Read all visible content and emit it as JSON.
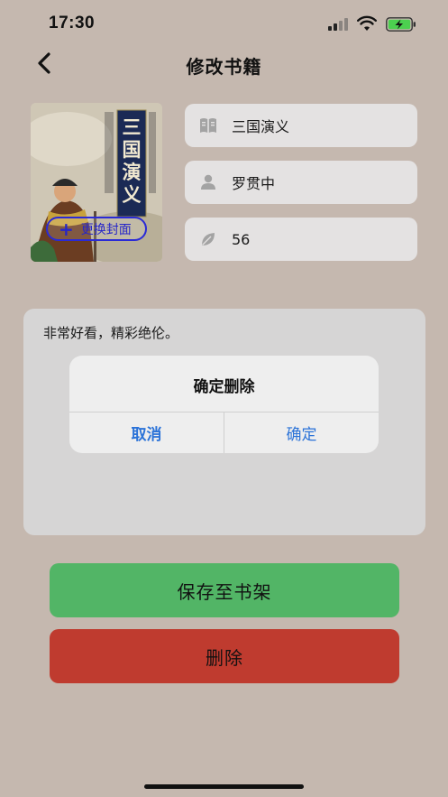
{
  "status_bar": {
    "time": "17:30",
    "icons": [
      "cellular-signal-icon",
      "wifi-icon",
      "battery-charging-icon"
    ]
  },
  "nav": {
    "title": "修改书籍",
    "back_icon": "chevron-left-icon"
  },
  "cover": {
    "book_title_on_cover": "三国演义",
    "change_cover_label": "更换封面",
    "plus_glyph": "+"
  },
  "fields": {
    "title": {
      "icon": "book-icon",
      "value": "三国演义"
    },
    "author": {
      "icon": "person-icon",
      "value": "罗贯中"
    },
    "rating": {
      "icon": "leaf-icon",
      "value": "56"
    }
  },
  "notes": {
    "text": "非常好看，精彩绝伦。"
  },
  "alert": {
    "title": "确定删除",
    "cancel_label": "取消",
    "confirm_label": "确定"
  },
  "actions": {
    "save_label": "保存至书架",
    "delete_label": "删除"
  },
  "colors": {
    "background": "#c5b8af",
    "save": "#52b566",
    "delete": "#bf3b2f",
    "alert_button": "#2b73d8"
  }
}
